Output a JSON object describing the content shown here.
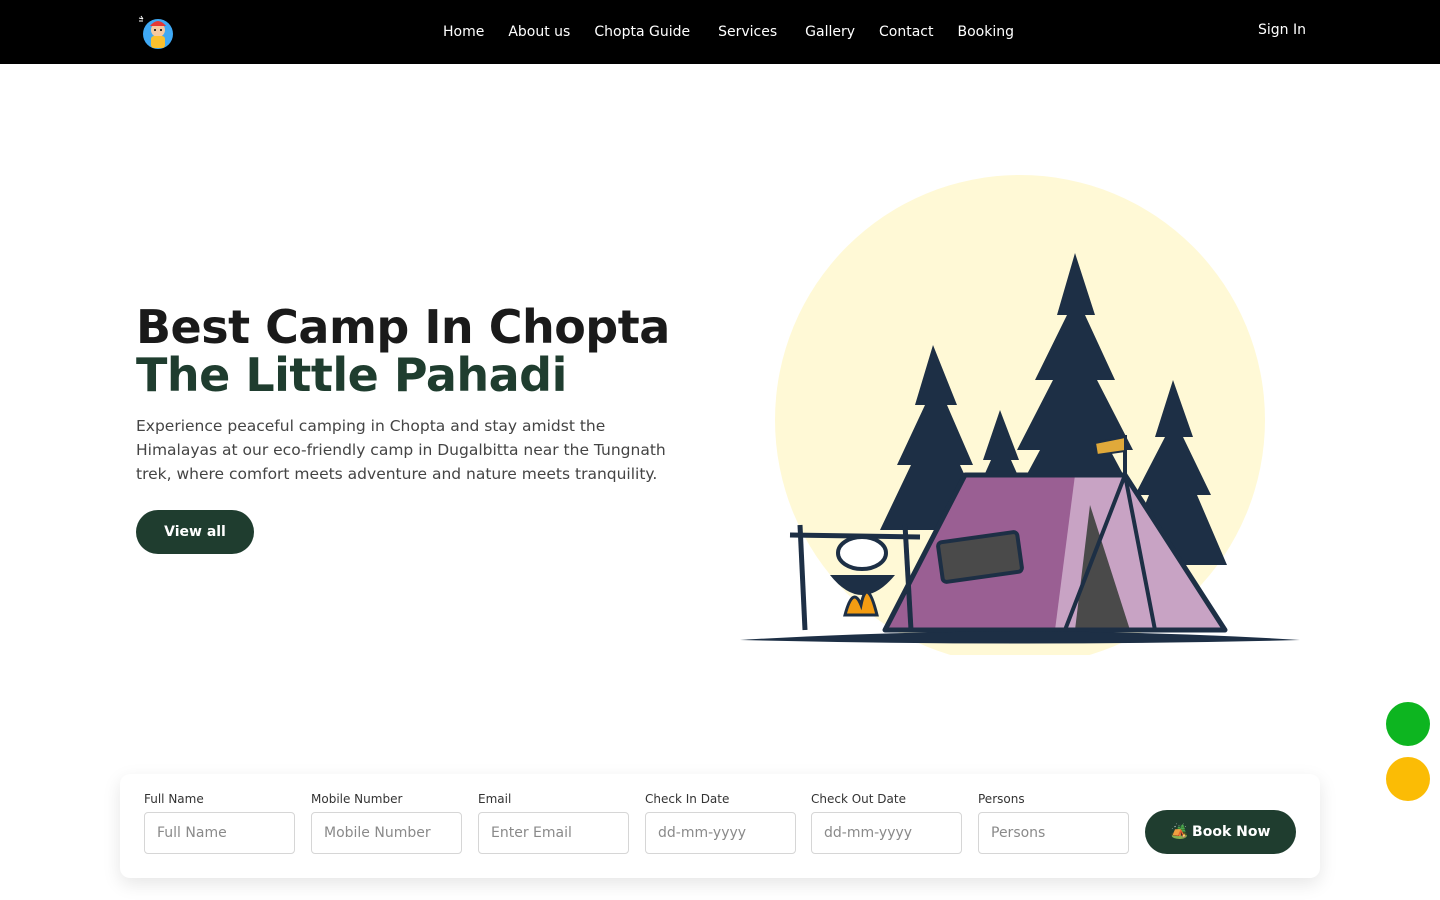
{
  "nav": {
    "logo_icon": "kid-camper-logo-icon",
    "links": [
      "Home",
      "About us",
      "Chopta Guide",
      "Services",
      "Gallery",
      "Contact",
      "Booking"
    ],
    "signin": "Sign In"
  },
  "hero": {
    "title_line1": "Best Camp In Chopta",
    "title_line2": "The Little Pahadi",
    "description": "Experience peaceful camping in Chopta and stay amidst the Himalayas at our eco-friendly camp in Dugalbitta near the Tungnath trek, where comfort meets adventure and nature meets tranquility.",
    "cta_label": "View all",
    "illustration": "camp-tent-illustration"
  },
  "floating": {
    "green_button": "whatsapp-icon",
    "yellow_button": "call-icon"
  },
  "booking": {
    "fields": [
      {
        "label": "Full Name",
        "placeholder": "Full Name"
      },
      {
        "label": "Mobile Number",
        "placeholder": "Mobile Number"
      },
      {
        "label": "Email",
        "placeholder": "Enter Email"
      },
      {
        "label": "Check In Date",
        "placeholder": "dd-mm-yyyy"
      },
      {
        "label": "Check Out Date",
        "placeholder": "dd-mm-yyyy"
      },
      {
        "label": "Persons",
        "placeholder": "Persons"
      }
    ],
    "submit_icon": "🏕️",
    "submit_label": "Book Now"
  },
  "colors": {
    "navbar": "#000000",
    "brand_green": "#1f3d2f",
    "sun": "#fff9d6",
    "tent": "#9a5f93",
    "trees": "#1d2f45",
    "float_green": "#0db520",
    "float_yellow": "#fbbc05"
  }
}
